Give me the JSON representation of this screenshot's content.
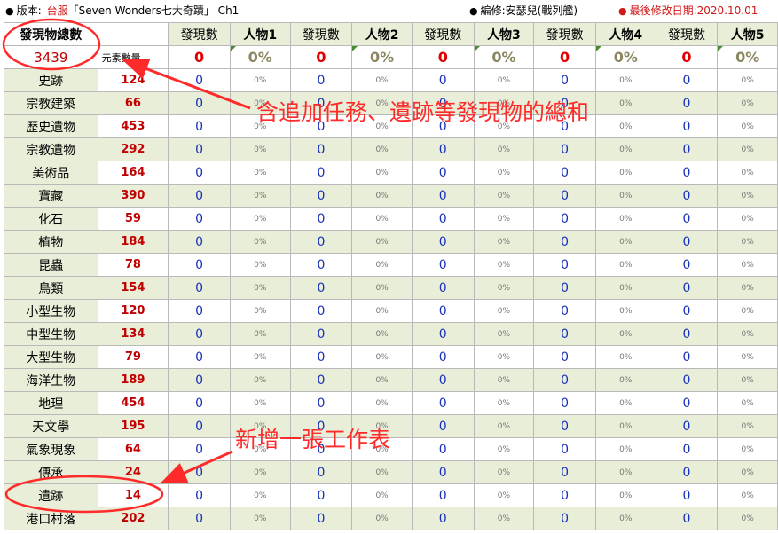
{
  "header": {
    "version_label": "版本:",
    "server": "台服",
    "game_title": "「Seven Wonders七大奇蹟」 Ch1",
    "editor_label": "編修:安瑟兒(戰列艦)",
    "modified_label": "最後修改日期:2020.10.01"
  },
  "table": {
    "total_label": "發現物總數",
    "total_value": "3439",
    "unit_label": "元素數量",
    "columns": [
      {
        "find": "發現數",
        "person": "人物1",
        "sum_find": "0",
        "sum_pct": "0%"
      },
      {
        "find": "發現數",
        "person": "人物2",
        "sum_find": "0",
        "sum_pct": "0%"
      },
      {
        "find": "發現數",
        "person": "人物3",
        "sum_find": "0",
        "sum_pct": "0%"
      },
      {
        "find": "發現數",
        "person": "人物4",
        "sum_find": "0",
        "sum_pct": "0%"
      },
      {
        "find": "發現數",
        "person": "人物5",
        "sum_find": "0",
        "sum_pct": "0%"
      }
    ],
    "cell_find": "0",
    "cell_pct": "0%",
    "rows": [
      {
        "name": "史跡",
        "count": "124"
      },
      {
        "name": "宗教建築",
        "count": "66"
      },
      {
        "name": "歷史遺物",
        "count": "453"
      },
      {
        "name": "宗教遺物",
        "count": "292"
      },
      {
        "name": "美術品",
        "count": "164"
      },
      {
        "name": "寶藏",
        "count": "390"
      },
      {
        "name": "化石",
        "count": "59"
      },
      {
        "name": "植物",
        "count": "184"
      },
      {
        "name": "昆蟲",
        "count": "78"
      },
      {
        "name": "鳥類",
        "count": "154"
      },
      {
        "name": "小型生物",
        "count": "120"
      },
      {
        "name": "中型生物",
        "count": "134"
      },
      {
        "name": "大型生物",
        "count": "79"
      },
      {
        "name": "海洋生物",
        "count": "189"
      },
      {
        "name": "地理",
        "count": "454"
      },
      {
        "name": "天文學",
        "count": "195"
      },
      {
        "name": "氣象現象",
        "count": "64"
      },
      {
        "name": "傳承",
        "count": "24"
      },
      {
        "name": "遺跡",
        "count": "14"
      },
      {
        "name": "港口村落",
        "count": "202"
      }
    ]
  },
  "annotations": {
    "callout_sum": "含追加任務、遺跡等發現物的總和",
    "callout_new_sheet": "新增一張工作表"
  },
  "colors": {
    "annotation": "#ff2a2a",
    "count_red": "#c00000",
    "find_blue": "#1830b8",
    "header_bg": "#e8eed8",
    "corner_mark": "#4a8d2e"
  }
}
